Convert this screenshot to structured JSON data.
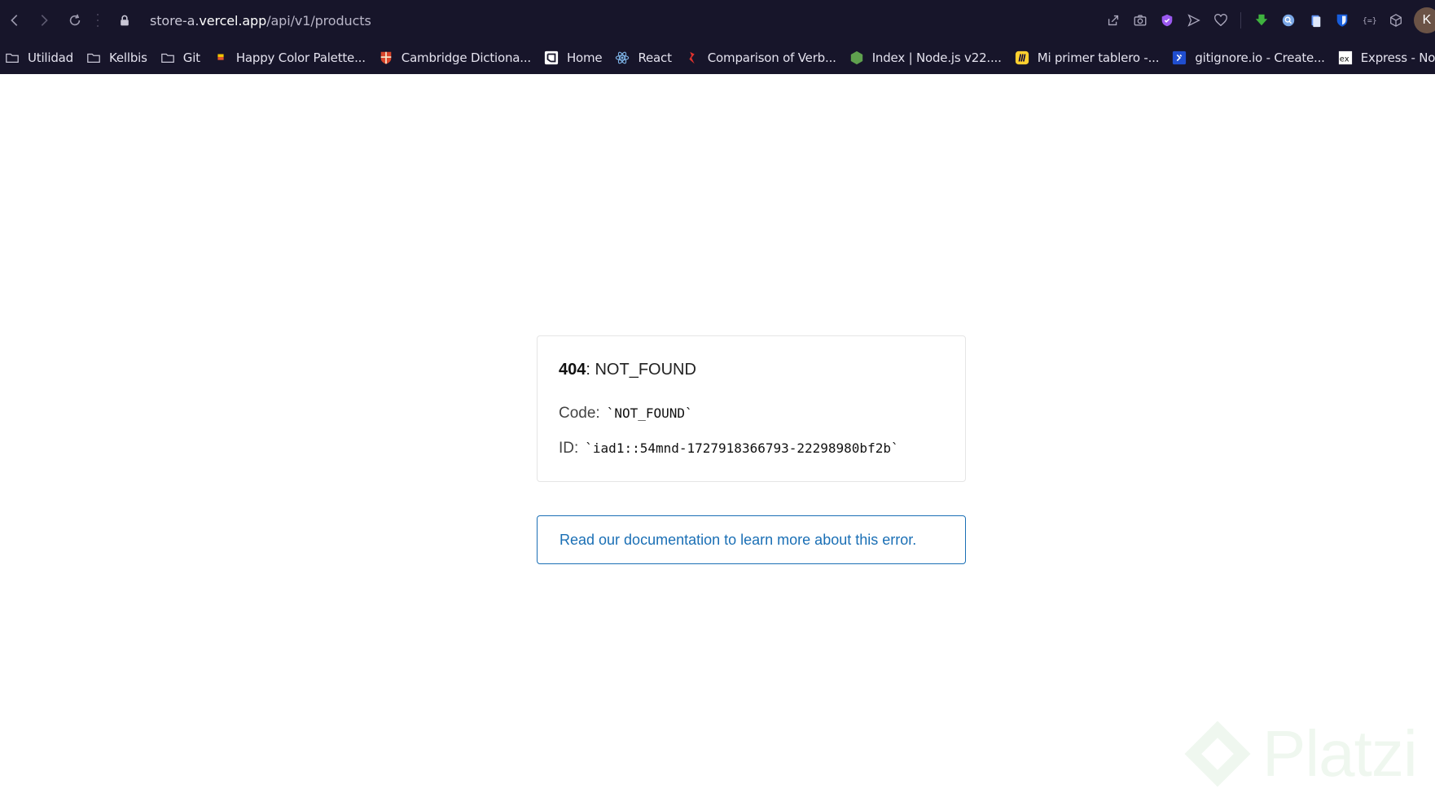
{
  "browser": {
    "url": {
      "prefix": "store-a.",
      "host": "vercel.app",
      "path": "/api/v1/products"
    },
    "avatar_initial": "K",
    "bookmarks": [
      {
        "label": "Utilidad",
        "icon": "folder-icon"
      },
      {
        "label": "Kellbis",
        "icon": "folder-icon"
      },
      {
        "label": "Git",
        "icon": "folder-icon"
      },
      {
        "label": "Happy Color Palette...",
        "icon": "palette-icon"
      },
      {
        "label": "Cambridge Dictiona...",
        "icon": "cambridge-icon"
      },
      {
        "label": "Home",
        "icon": "home-site-icon"
      },
      {
        "label": "React",
        "icon": "react-icon"
      },
      {
        "label": "Comparison of Verb...",
        "icon": "red-bookmark-icon"
      },
      {
        "label": "Index | Node.js v22....",
        "icon": "nodejs-icon"
      },
      {
        "label": "Mi primer tablero -...",
        "icon": "miro-icon"
      },
      {
        "label": "gitignore.io - Create...",
        "icon": "gitignore-icon"
      },
      {
        "label": "Express - Node.js w...",
        "icon": "express-icon"
      }
    ]
  },
  "error": {
    "status_code": "404",
    "status_text": ": NOT_FOUND",
    "code_label": "Code:",
    "code_value": "`NOT_FOUND`",
    "id_label": "ID:",
    "id_value": "`iad1::54mnd-1727918366793-22298980bf2b`",
    "doc_link": "Read our documentation to learn more about this error."
  },
  "watermark": "Platzi"
}
